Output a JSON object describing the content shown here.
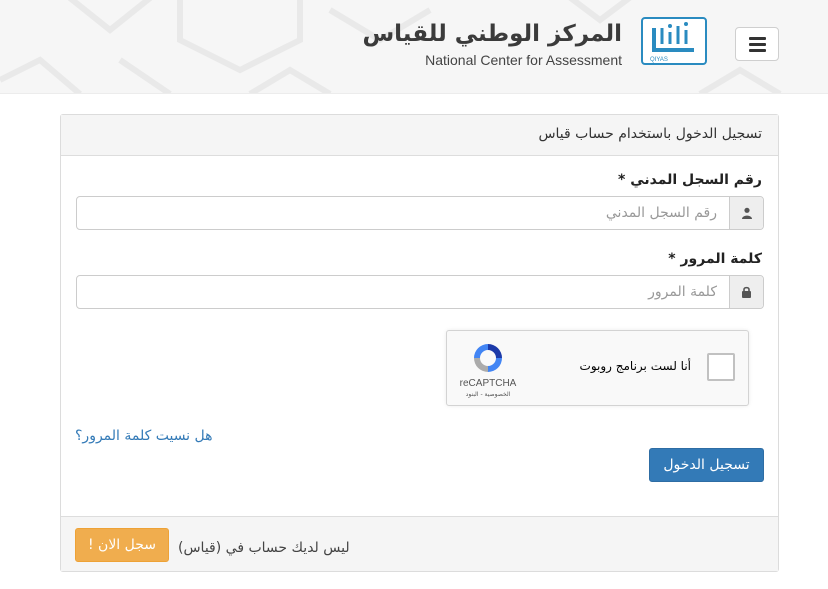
{
  "header": {
    "brand_ar": "المركز الوطني للقياس",
    "brand_en": "National Center for Assessment",
    "logo_caption": "QIYAS",
    "menu_icon": "hamburger-menu-icon"
  },
  "panel": {
    "title": "تسجيل الدخول باستخدام حساب قياس",
    "id_field": {
      "label": "رقم السجل المدني *",
      "placeholder": "رقم السجل المدني",
      "value": "",
      "icon": "user-icon"
    },
    "password_field": {
      "label": "كلمة المرور *",
      "placeholder": "كلمة المرور",
      "value": "",
      "icon": "lock-icon"
    },
    "captcha": {
      "text": "أنا لست برنامج روبوت",
      "brand": "reCAPTCHA",
      "links": "الخصوصية - البنود"
    },
    "forgot_link": "هل نسيت كلمة المرور؟",
    "login_button": "تسجيل الدخول",
    "footer": {
      "text": "ليس لديك حساب في (قياس)",
      "register_button": "سجل الان !"
    }
  },
  "colors": {
    "primary": "#337ab7",
    "warning": "#f0ad4e",
    "logo_blue": "#2a8bc0"
  }
}
